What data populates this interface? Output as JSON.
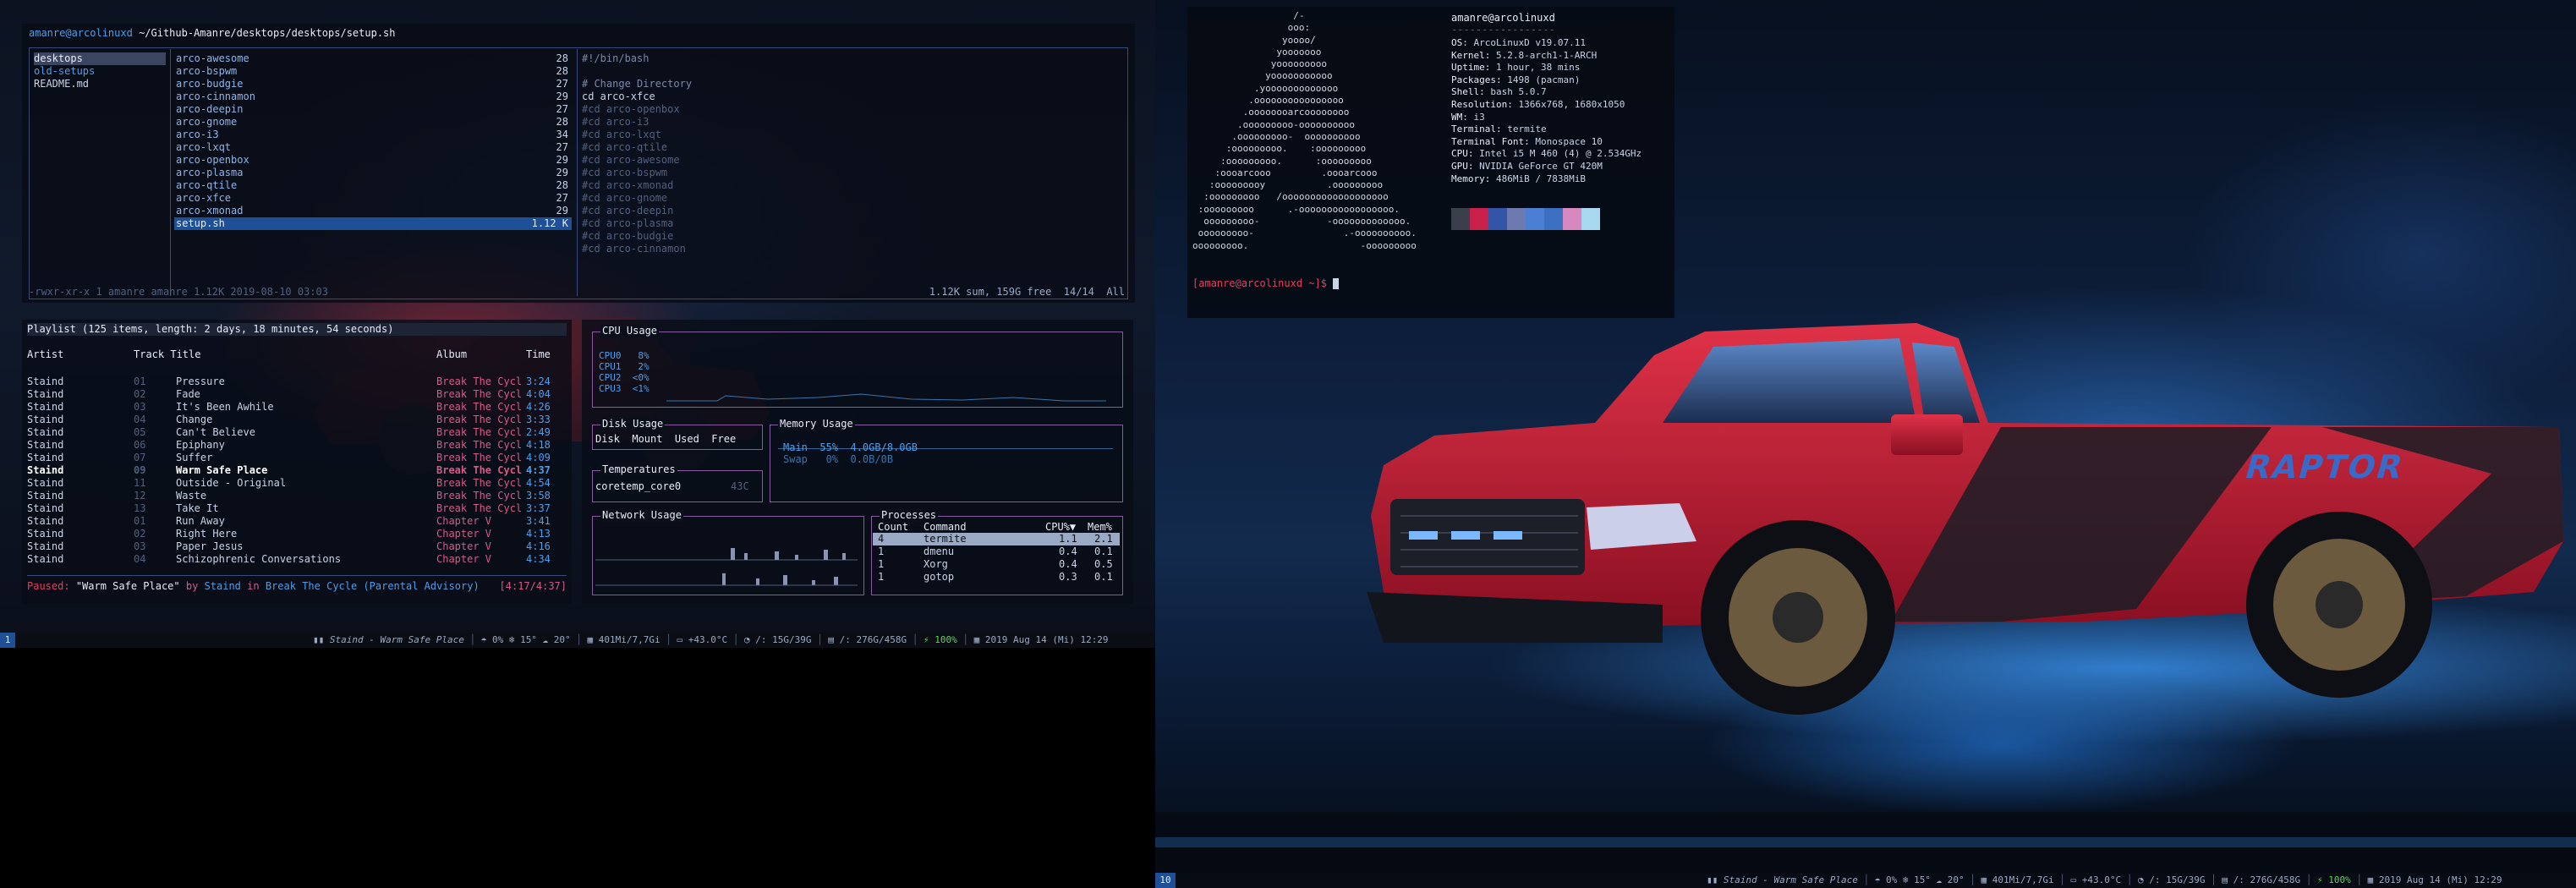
{
  "left_screen": {
    "ranger": {
      "path_user": "amanre@arcolinuxd",
      "path": "~/Github-Amanre/desktops/desktops/setup.sh",
      "col1": [
        "desktops",
        "old-setups",
        "README.md"
      ],
      "col2": [
        {
          "name": "arco-awesome",
          "n": "28"
        },
        {
          "name": "arco-bspwm",
          "n": "28"
        },
        {
          "name": "arco-budgie",
          "n": "27"
        },
        {
          "name": "arco-cinnamon",
          "n": "29"
        },
        {
          "name": "arco-deepin",
          "n": "27"
        },
        {
          "name": "arco-gnome",
          "n": "28"
        },
        {
          "name": "arco-i3",
          "n": "34"
        },
        {
          "name": "arco-lxqt",
          "n": "27"
        },
        {
          "name": "arco-openbox",
          "n": "29"
        },
        {
          "name": "arco-plasma",
          "n": "29"
        },
        {
          "name": "arco-qtile",
          "n": "28"
        },
        {
          "name": "arco-xfce",
          "n": "27"
        },
        {
          "name": "arco-xmonad",
          "n": "29"
        },
        {
          "name": "setup.sh",
          "n": "1.12 K"
        }
      ],
      "preview": [
        "#!/bin/bash",
        "",
        "# Change Directory",
        "cd arco-xfce",
        "#cd arco-openbox",
        "#cd arco-i3",
        "#cd arco-lxqt",
        "#cd arco-qtile",
        "#cd arco-awesome",
        "#cd arco-bspwm",
        "#cd arco-xmonad",
        "#cd arco-gnome",
        "#cd arco-deepin",
        "#cd arco-plasma",
        "#cd arco-budgie",
        "#cd arco-cinnamon"
      ],
      "status_left": "-rwxr-xr-x 1 amanre amanre 1.12K 2019-08-10 03:03",
      "status_right": "1.12K sum, 159G free  14/14  All"
    },
    "cmus": {
      "header": "Playlist (125 items, length: 2 days, 18 minutes, 54 seconds)",
      "col_artist": "Artist",
      "col_track": "Track Title",
      "col_album": "Album",
      "col_time": "Time",
      "rows": [
        {
          "artist": "Staind",
          "num": "01",
          "title": "Pressure",
          "album": "Break The Cycl",
          "time": "3:24"
        },
        {
          "artist": "Staind",
          "num": "02",
          "title": "Fade",
          "album": "Break The Cycl",
          "time": "4:04"
        },
        {
          "artist": "Staind",
          "num": "03",
          "title": "It's Been Awhile",
          "album": "Break The Cycl",
          "time": "4:26"
        },
        {
          "artist": "Staind",
          "num": "04",
          "title": "Change",
          "album": "Break The Cycl",
          "time": "3:33"
        },
        {
          "artist": "Staind",
          "num": "05",
          "title": "Can't Believe",
          "album": "Break The Cycl",
          "time": "2:49"
        },
        {
          "artist": "Staind",
          "num": "06",
          "title": "Epiphany",
          "album": "Break The Cycl",
          "time": "4:18"
        },
        {
          "artist": "Staind",
          "num": "07",
          "title": "Suffer",
          "album": "Break The Cycl",
          "time": "4:09"
        },
        {
          "artist": "Staind",
          "num": "09",
          "title": "Warm Safe Place",
          "album": "Break The Cycl",
          "time": "4:37"
        },
        {
          "artist": "Staind",
          "num": "11",
          "title": "Outside - Original",
          "album": "Break The Cycl",
          "time": "4:54"
        },
        {
          "artist": "Staind",
          "num": "12",
          "title": "Waste",
          "album": "Break The Cycl",
          "time": "3:58"
        },
        {
          "artist": "Staind",
          "num": "13",
          "title": "Take It",
          "album": "Break The Cycl",
          "time": "3:37"
        },
        {
          "artist": "Staind",
          "num": "01",
          "title": "Run Away",
          "album": "Chapter V",
          "time": "3:41"
        },
        {
          "artist": "Staind",
          "num": "02",
          "title": "Right Here",
          "album": "Chapter V",
          "time": "4:13"
        },
        {
          "artist": "Staind",
          "num": "03",
          "title": "Paper Jesus",
          "album": "Chapter V",
          "time": "4:16"
        },
        {
          "artist": "Staind",
          "num": "04",
          "title": "Schizophrenic Conversations",
          "album": "Chapter V",
          "time": "4:34"
        }
      ],
      "status_paused": "Paused:",
      "status_song": "\"Warm Safe Place\"",
      "status_by": "by",
      "status_artist": "Staind",
      "status_in": "in",
      "status_album": "Break The Cycle (Parental Advisory)",
      "status_time": "[4:17/4:37]"
    },
    "gotop": {
      "cpu_title": "CPU Usage",
      "cpu_rows": [
        "CPU0   8%",
        "CPU1   2%",
        "CPU2  <0%",
        "CPU3  <1%"
      ],
      "disk_title": "Disk Usage",
      "disk_headers": "Disk  Mount  Used  Free",
      "mem_title": "Memory Usage",
      "mem_main": "Main  55%  4.0GB/8.0GB",
      "mem_swap": "Swap   0%  0.0B/0B",
      "temp_title": "Temperatures",
      "temp_row": "coretemp_core0",
      "temp_val": "43C",
      "net_title": "Network Usage",
      "proc_title": "Processes",
      "proc_headers": [
        "Count",
        "Command",
        "CPU%▼",
        "Mem%"
      ],
      "procs": [
        {
          "count": "4",
          "cmd": "termite",
          "cpu": "1.1",
          "mem": "2.1"
        },
        {
          "count": "1",
          "cmd": "dmenu",
          "cpu": "0.4",
          "mem": "0.1"
        },
        {
          "count": "1",
          "cmd": "Xorg",
          "cpu": "0.4",
          "mem": "0.5"
        },
        {
          "count": "1",
          "cmd": "gotop",
          "cpu": "0.3",
          "mem": "0.1"
        }
      ]
    },
    "bar": {
      "workspace": "1",
      "now_playing": "Staind - Warm Safe Place",
      "weather": "0%  ❄ 15°  ☁ 20°",
      "memory": "401Mi/7,7Gi",
      "temp": "+43.0°C",
      "root_disk": "/: 15G/39G",
      "home_disk": "/: 276G/458G",
      "battery": "100%",
      "datetime": "2019 Aug 14 (Mi) 12:29"
    }
  },
  "right_screen": {
    "neofetch": {
      "user_host": "amanre@arcolinuxd",
      "separator": "-----------------",
      "ascii": [
        "                  /-",
        "                 ooo:",
        "                yoooo/",
        "               yooooooo",
        "              yooooooooo",
        "             yooooooooooo",
        "           .yooooooooooooo",
        "          .oooooooooooooooo",
        "         .oooooooarcoooooooo",
        "        .ooooooooo-oooooooooo",
        "       .ooooooooo-  oooooooooo",
        "      :ooooooooo.    :ooooooooo",
        "     :ooooooooo.      :ooooooooo",
        "    :oooarcooo         .oooarcooo",
        "   :ooooooooy           .ooooooooo",
        "  :ooooooooo   /ooooooooooooooooooo",
        " :ooooooooo      .-ooooooooooooooooo.",
        "  ooooooooo-            -ooooooooooooo.",
        " ooooooooo-                .-oooooooooo.",
        "ooooooooo.                    -ooooooooo"
      ],
      "info": [
        {
          "k": "OS",
          "v": "ArcoLinuxD v19.07.11"
        },
        {
          "k": "Kernel",
          "v": "5.2.8-arch1-1-ARCH"
        },
        {
          "k": "Uptime",
          "v": "1 hour, 38 mins"
        },
        {
          "k": "Packages",
          "v": "1498 (pacman)"
        },
        {
          "k": "Shell",
          "v": "bash 5.0.7"
        },
        {
          "k": "Resolution",
          "v": "1366x768, 1680x1050"
        },
        {
          "k": "WM",
          "v": "i3"
        },
        {
          "k": "Terminal",
          "v": "termite"
        },
        {
          "k": "Terminal Font",
          "v": "Monospace 10"
        },
        {
          "k": "CPU",
          "v": "Intel i5 M 460 (4) @ 2.534GHz"
        },
        {
          "k": "GPU",
          "v": "NVIDIA GeForce GT 420M"
        },
        {
          "k": "Memory",
          "v": "486MiB / 7838MiB"
        }
      ],
      "palette": [
        "#3b3f4c",
        "#c8204a",
        "#3355a8",
        "#6c7ab0",
        "#4a7fd4",
        "#3b6fbf",
        "#d888c0",
        "#a8d8f0"
      ],
      "prompt_user": "[amanre@arcolinuxd ~]$"
    },
    "truck_badge": "RAPTOR",
    "bar": {
      "workspace": "10",
      "now_playing": "Staind - Warm Safe Place",
      "weather": "0%  ❄ 15°  ☁ 20°",
      "memory": "401Mi/7,7Gi",
      "temp": "+43.0°C",
      "root_disk": "/: 15G/39G",
      "home_disk": "/: 276G/458G",
      "battery": "100%",
      "datetime": "2019 Aug 14 (Mi) 12:29"
    }
  },
  "colors": {
    "accent": "#4f9ee8",
    "pink": "#d75a86",
    "red": "#e2415f",
    "selection": "#1f4f96"
  }
}
